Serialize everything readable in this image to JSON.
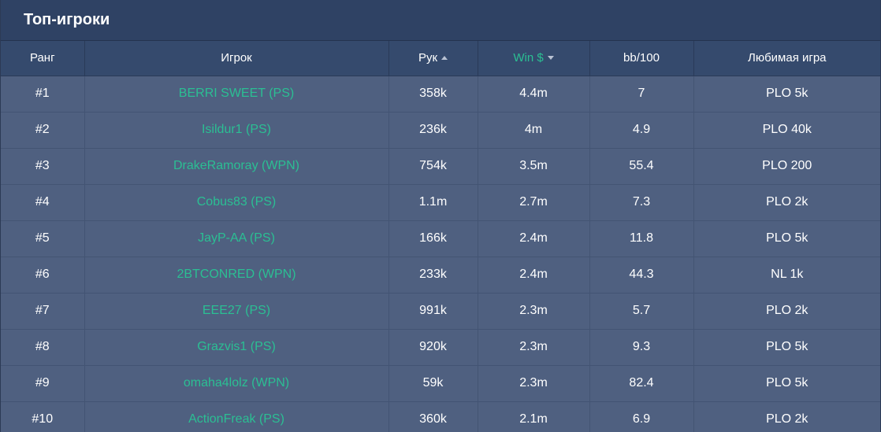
{
  "panel": {
    "title": "Топ-игроки"
  },
  "table": {
    "headers": {
      "rank": "Ранг",
      "player": "Игрок",
      "hands": "Рук",
      "win": "Win $",
      "bb100": "bb/100",
      "favorite_game": "Любимая игра"
    },
    "rows": [
      {
        "rank": "#1",
        "player": "BERRI SWEET (PS)",
        "hands": "358k",
        "win": "4.4m",
        "bb100": "7",
        "game": "PLO 5k"
      },
      {
        "rank": "#2",
        "player": "Isildur1 (PS)",
        "hands": "236k",
        "win": "4m",
        "bb100": "4.9",
        "game": "PLO 40k"
      },
      {
        "rank": "#3",
        "player": "DrakeRamoray (WPN)",
        "hands": "754k",
        "win": "3.5m",
        "bb100": "55.4",
        "game": "PLO 200"
      },
      {
        "rank": "#4",
        "player": "Cobus83 (PS)",
        "hands": "1.1m",
        "win": "2.7m",
        "bb100": "7.3",
        "game": "PLO 2k"
      },
      {
        "rank": "#5",
        "player": "JayP-AA (PS)",
        "hands": "166k",
        "win": "2.4m",
        "bb100": "11.8",
        "game": "PLO 5k"
      },
      {
        "rank": "#6",
        "player": "2BTCONRED (WPN)",
        "hands": "233k",
        "win": "2.4m",
        "bb100": "44.3",
        "game": "NL 1k"
      },
      {
        "rank": "#7",
        "player": "EEE27 (PS)",
        "hands": "991k",
        "win": "2.3m",
        "bb100": "5.7",
        "game": "PLO 2k"
      },
      {
        "rank": "#8",
        "player": "Grazvis1 (PS)",
        "hands": "920k",
        "win": "2.3m",
        "bb100": "9.3",
        "game": "PLO 5k"
      },
      {
        "rank": "#9",
        "player": "omaha4lolz (WPN)",
        "hands": "59k",
        "win": "2.3m",
        "bb100": "82.4",
        "game": "PLO 5k"
      },
      {
        "rank": "#10",
        "player": "ActionFreak (PS)",
        "hands": "360k",
        "win": "2.1m",
        "bb100": "6.9",
        "game": "PLO 2k"
      }
    ]
  },
  "colors": {
    "accent": "#2bbf93",
    "header_bg": "#2f4264",
    "row_bg": "#4f6080"
  },
  "icons": {
    "hands_sort": "caret-up-icon",
    "win_sort": "caret-down-icon"
  }
}
